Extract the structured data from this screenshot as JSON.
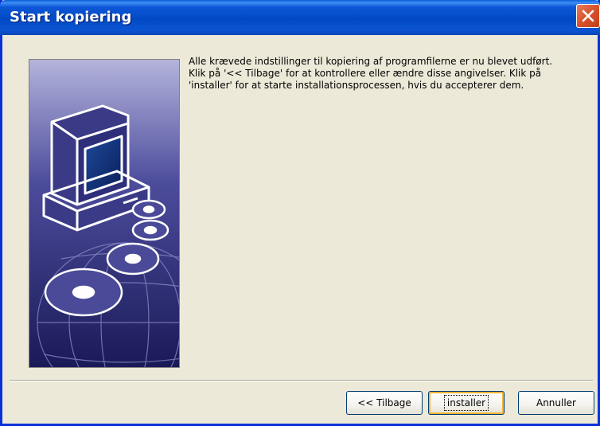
{
  "window": {
    "title": "Start kopiering",
    "close_icon": "close-icon"
  },
  "illustration": {
    "description_icon": "computer-discs-globe-illustration",
    "colors": {
      "top": "#b0b0d8",
      "bottom": "#1e1e5e"
    }
  },
  "message": "Alle krævede indstillinger til kopiering af programfilerne er nu blevet udført. Klik på '<< Tilbage' for at kontrollere eller ændre disse angivelser. Klik på 'installer' for at starte installationsprocessen, hvis du accepterer dem.",
  "buttons": {
    "back": "<< Tilbage",
    "install": "installer",
    "cancel": "Annuller"
  },
  "colors": {
    "titlebar": "#0149c4",
    "close": "#d9512b",
    "face": "#ece9d8"
  }
}
